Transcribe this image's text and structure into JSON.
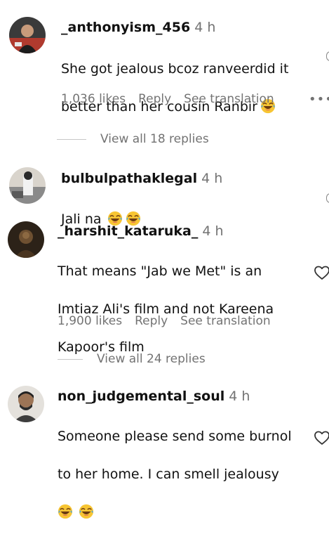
{
  "comments": [
    {
      "username": "_anthonyism_456",
      "time": "4 h",
      "line1": "She got jealous bcoz ranveerdid it",
      "line2": "better than her cousin Ranbir",
      "likes": "1,036 likes",
      "reply": "Reply",
      "translate": "See translation",
      "more": "•••",
      "view_replies": "View all 18 replies"
    },
    {
      "username": "bulbulpathaklegal",
      "time": "4 h",
      "line1": "Jali na"
    },
    {
      "username": "_harshit_kataruka_",
      "time": "4 h",
      "line1": "That means \"Jab we Met\" is an",
      "line2": "Imtiaz Ali's film and not Kareena",
      "line3": "Kapoor's film",
      "likes": "1,900 likes",
      "reply": "Reply",
      "translate": "See translation",
      "view_replies": "View all 24 replies"
    },
    {
      "username": "non_judgemental_soul",
      "time": "4 h",
      "line1": "Someone please send some burnol",
      "line2": "to her home. I can smell jealousy"
    }
  ],
  "icons": {
    "emoji": "laughing-face-emoji",
    "heart": "heart-outline-icon"
  }
}
